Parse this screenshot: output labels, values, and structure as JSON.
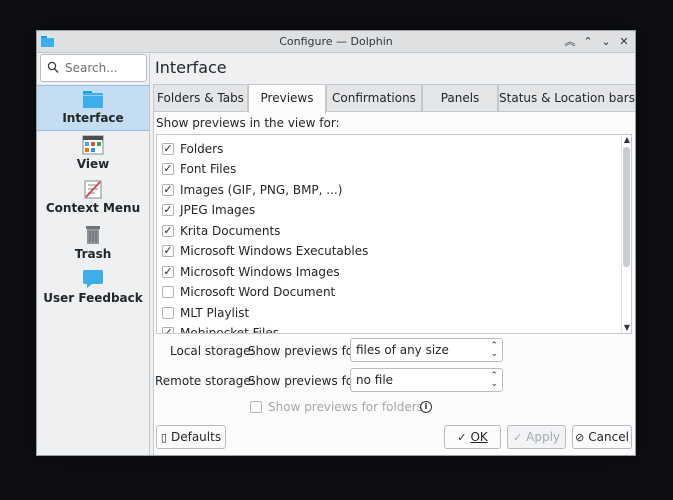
{
  "window": {
    "title": "Configure — Dolphin",
    "buttons": [
      "︽",
      "⌃",
      "⌄",
      "✕"
    ]
  },
  "search": {
    "placeholder": "Search..."
  },
  "sidebar": {
    "items": [
      {
        "label": "Interface",
        "icon": "folder-icon",
        "active": true
      },
      {
        "label": "View",
        "icon": "view-grid-icon",
        "active": false
      },
      {
        "label": "Context Menu",
        "icon": "context-menu-icon",
        "active": false
      },
      {
        "label": "Trash",
        "icon": "trash-icon",
        "active": false
      },
      {
        "label": "User Feedback",
        "icon": "feedback-icon",
        "active": false
      }
    ]
  },
  "page": {
    "title": "Interface"
  },
  "tabs": [
    {
      "label": "Folders & Tabs",
      "active": false
    },
    {
      "label": "Previews",
      "active": true
    },
    {
      "label": "Confirmations",
      "active": false
    },
    {
      "label": "Panels",
      "active": false
    },
    {
      "label": "Status & Location bars",
      "active": false
    }
  ],
  "previews": {
    "section_label": "Show previews in the view for:",
    "items": [
      {
        "label": "Folders",
        "checked": true
      },
      {
        "label": "Font Files",
        "checked": true
      },
      {
        "label": "Images (GIF, PNG, BMP, ...)",
        "checked": true
      },
      {
        "label": "JPEG Images",
        "checked": true
      },
      {
        "label": "Krita Documents",
        "checked": true
      },
      {
        "label": "Microsoft Windows Executables",
        "checked": true
      },
      {
        "label": "Microsoft Windows Images",
        "checked": true
      },
      {
        "label": "Microsoft Word Document",
        "checked": false
      },
      {
        "label": "MLT Playlist",
        "checked": false
      },
      {
        "label": "Mobipocket Files",
        "checked": true
      }
    ]
  },
  "local_storage": {
    "label": "Local storage:",
    "sublabel": "Show previews for",
    "value": "files of any size"
  },
  "remote_storage": {
    "label": "Remote storage:",
    "sublabel": "Show previews for",
    "value": "no file"
  },
  "folders_option": {
    "label": "Show previews for folders",
    "checked": false,
    "enabled": false
  },
  "footer": {
    "defaults_label": "Defaults",
    "ok_label": "OK",
    "apply_label": "Apply",
    "cancel_label": "Cancel"
  },
  "colors": {
    "accent": "#3daee9",
    "selection": "#c5ddf2",
    "window_bg": "#eff0f1",
    "desktop_bg": "#0e0f14"
  }
}
